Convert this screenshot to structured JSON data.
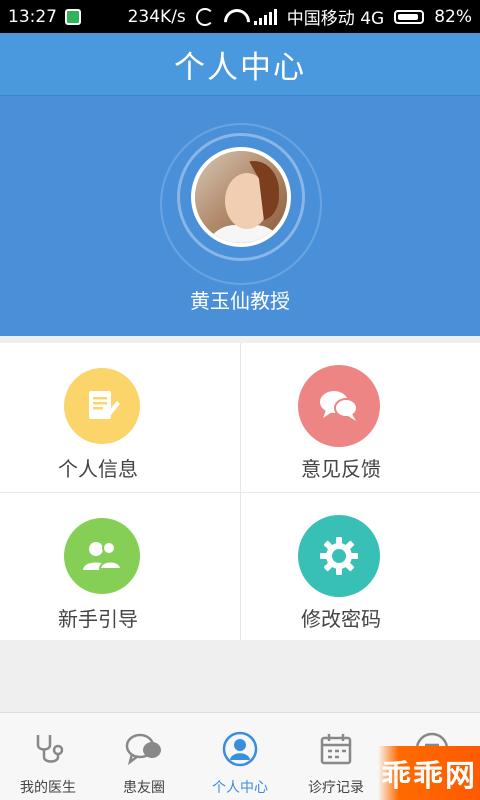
{
  "status_bar": {
    "time": "13:27",
    "network_speed": "234K/s",
    "carrier": "中国移动 4G",
    "battery": "82%"
  },
  "header": {
    "title": "个人中心"
  },
  "profile": {
    "name": "黄玉仙教授"
  },
  "menu": {
    "items": [
      {
        "label": "个人信息",
        "icon": "edit-document-icon",
        "color": "#fbd56a"
      },
      {
        "label": "意见反馈",
        "icon": "chat-bubbles-icon",
        "color": "#ee8585"
      },
      {
        "label": "新手引导",
        "icon": "users-icon",
        "color": "#86cf56"
      },
      {
        "label": "修改密码",
        "icon": "gear-icon",
        "color": "#39c0b6"
      }
    ]
  },
  "tabbar": {
    "items": [
      {
        "label": "我的医生",
        "icon": "stethoscope-icon"
      },
      {
        "label": "患友圈",
        "icon": "chat-icon"
      },
      {
        "label": "个人中心",
        "icon": "user-circle-icon",
        "active": true
      },
      {
        "label": "诊疗记录",
        "icon": "calendar-icon"
      },
      {
        "label": "",
        "icon": "more-icon"
      }
    ]
  },
  "watermark": {
    "text": "乖乖网"
  },
  "colors": {
    "header_blue": "#4a98dd",
    "profile_blue": "#4a90d9",
    "tab_active": "#3a8ee0"
  }
}
